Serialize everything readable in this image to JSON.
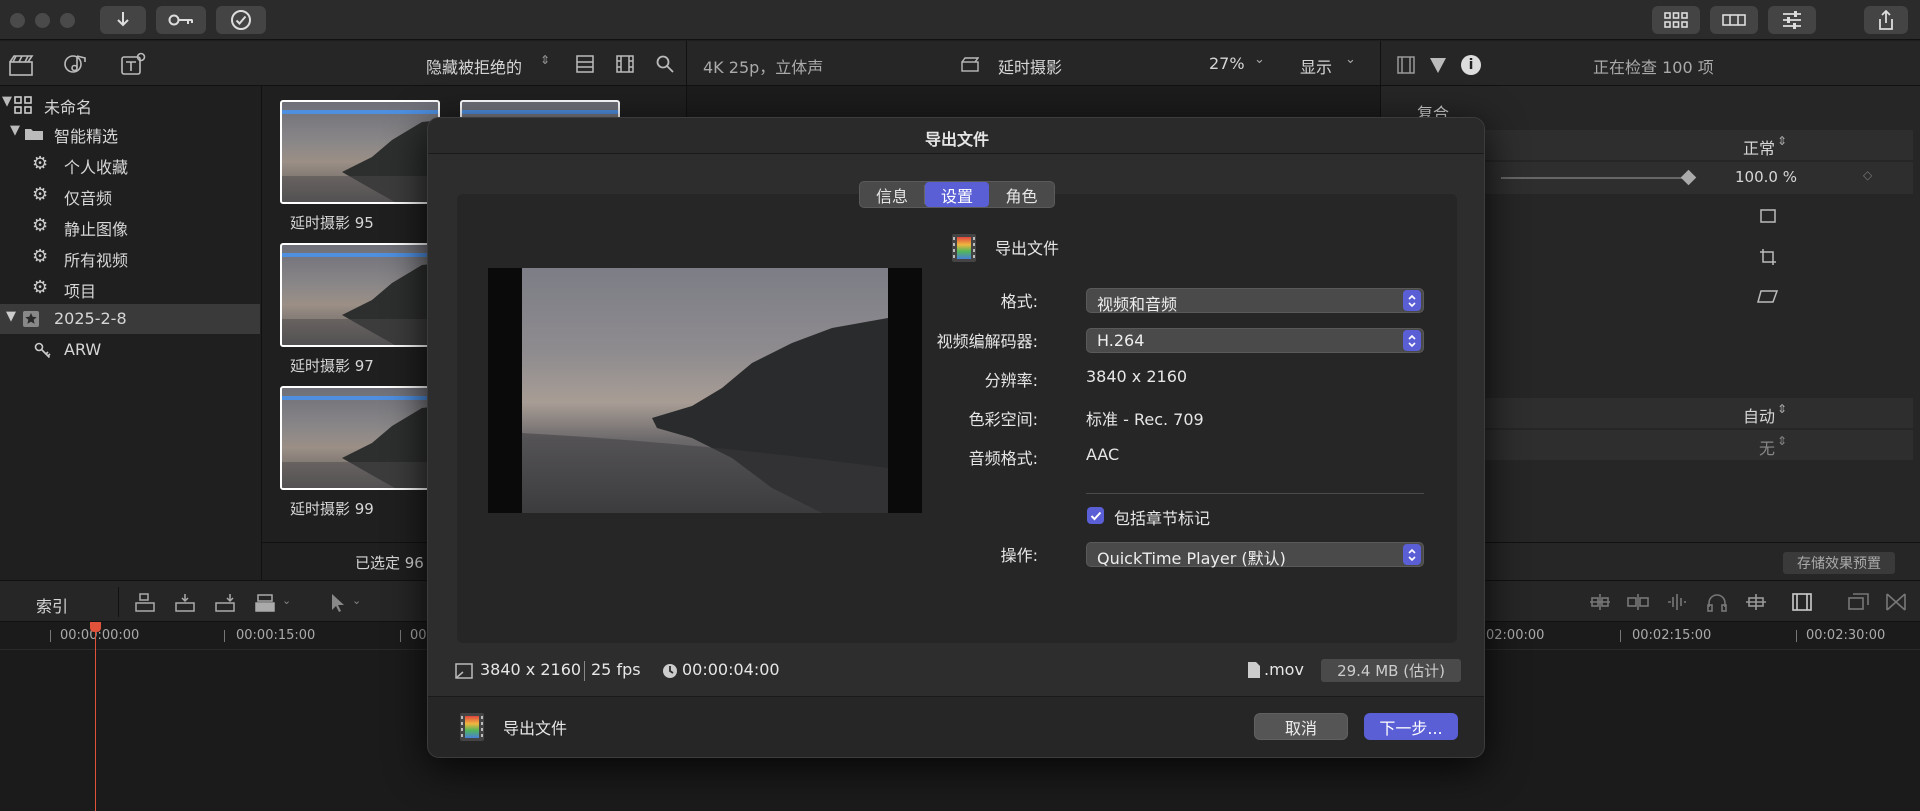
{
  "toolbar": {
    "import_icon": "download-arrow-icon",
    "keyword_icon": "key-icon",
    "check_icon": "checkmark-circle-icon"
  },
  "library": {
    "filter_label": "隐藏被拒绝的",
    "items": [
      {
        "label": "未命名",
        "icon": "library-grid-icon"
      },
      {
        "label": "智能精选",
        "icon": "folder-icon"
      },
      {
        "label": "个人收藏",
        "icon": "gear-icon"
      },
      {
        "label": "仅音频",
        "icon": "gear-icon"
      },
      {
        "label": "静止图像",
        "icon": "gear-icon"
      },
      {
        "label": "所有视频",
        "icon": "gear-icon"
      },
      {
        "label": "项目",
        "icon": "gear-icon"
      },
      {
        "label": "2025-2-8",
        "icon": "star-event-icon"
      },
      {
        "label": "ARW",
        "icon": "keyword-icon"
      }
    ]
  },
  "browser": {
    "clips": [
      "延时摄影 95",
      "延时摄影 97",
      "延时摄影 99"
    ],
    "selection_status": "已选定 96"
  },
  "viewer": {
    "format_label": "4K 25p，立体声",
    "project_name": "延时摄影",
    "zoom": "27%",
    "display_label": "显示"
  },
  "inspector": {
    "title": "正在检查 100 项",
    "section": "复合",
    "blend_mode": "正常",
    "opacity": "100.0 %",
    "auto_label": "自动",
    "none_label": "无",
    "save_preset": "存储效果预置"
  },
  "timeline": {
    "index_label": "索引",
    "timecodes": [
      "00:00:00:00",
      "00:00:15:00",
      "00",
      "02:00:00",
      "00:02:15:00",
      "00:02:30:00"
    ]
  },
  "dialog": {
    "title": "导出文件",
    "tabs": [
      "信息",
      "设置",
      "角色"
    ],
    "active_tab": 1,
    "export_name": "导出文件",
    "rows": [
      {
        "label": "格式:",
        "value": "视频和音频",
        "type": "select"
      },
      {
        "label": "视频编解码器:",
        "value": "H.264",
        "type": "select"
      },
      {
        "label": "分辨率:",
        "value": "3840 x 2160",
        "type": "text"
      },
      {
        "label": "色彩空间:",
        "value": "标准 - Rec. 709",
        "type": "text"
      },
      {
        "label": "音频格式:",
        "value": "AAC",
        "type": "text"
      }
    ],
    "chapter_markers": "包括章节标记",
    "chapter_checked": true,
    "action_label": "操作:",
    "action_value": "QuickTime Player (默认)",
    "footer_resolution": "3840 x 2160",
    "footer_fps": "25 fps",
    "footer_duration": "00:00:04:00",
    "footer_ext": ".mov",
    "footer_size": "29.4 MB (估计)",
    "bottom_name": "导出文件",
    "cancel": "取消",
    "next": "下一步..."
  },
  "colors": {
    "accent": "#5a5fd6",
    "playhead": "#e0523a"
  }
}
